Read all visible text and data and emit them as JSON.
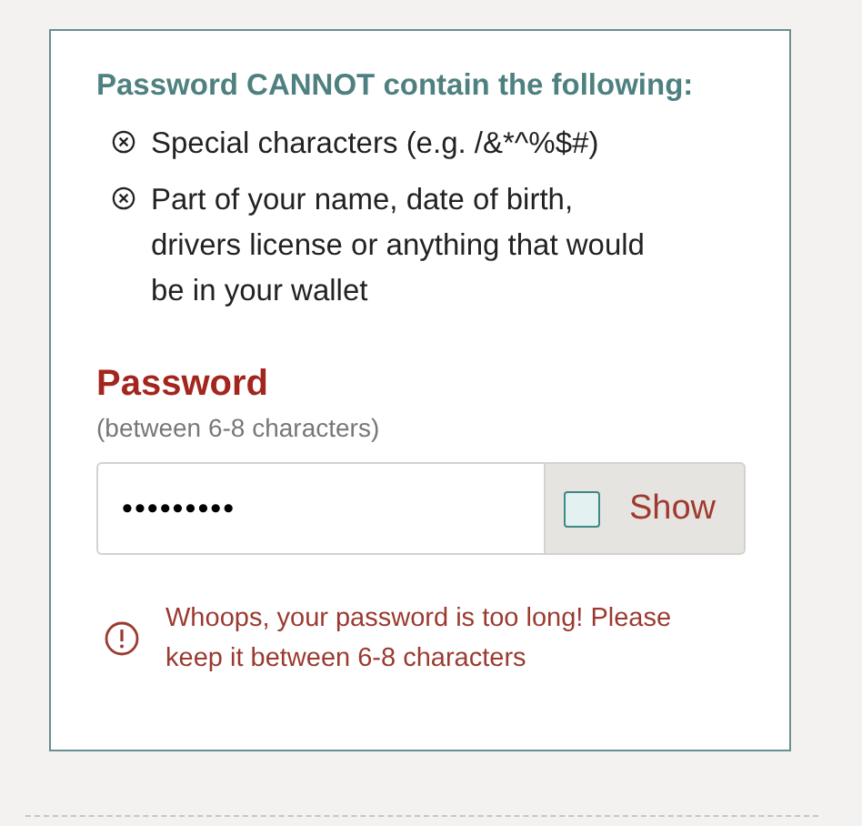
{
  "rules": {
    "heading": "Password CANNOT contain the following:",
    "items": [
      {
        "text": "Special characters (e.g. /&*^%$#)"
      },
      {
        "text": "Part of your name, date of birth, drivers license or anything that would be in your wallet"
      }
    ]
  },
  "password": {
    "label": "Password",
    "hint": "(between 6-8 characters)",
    "value": "•••••••••",
    "show": {
      "label": "Show",
      "checked": false
    },
    "error": "Whoops, your password is too long! Please keep it between 6-8 characters"
  }
}
